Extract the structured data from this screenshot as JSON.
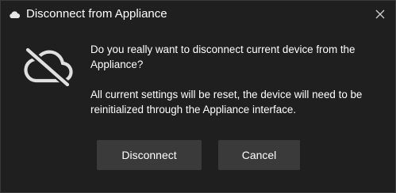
{
  "window": {
    "title": "Disconnect from Appliance",
    "title_icon": "cloud-icon",
    "close_icon": "close-icon"
  },
  "dialog": {
    "icon": "cloud-off-icon",
    "question": "Do you really want to disconnect current device from the Appliance?",
    "detail": "All current settings will be reset, the device will need to be reinitialized through the Appliance interface."
  },
  "buttons": {
    "disconnect_label": "Disconnect",
    "cancel_label": "Cancel"
  },
  "colors": {
    "background": "#1f1f1f",
    "button": "#3a3a3a",
    "text": "#ffffff"
  }
}
